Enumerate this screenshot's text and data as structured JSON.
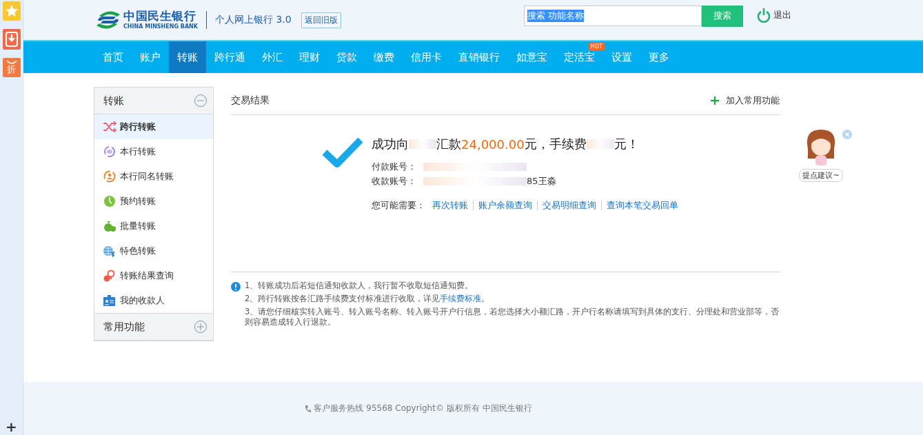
{
  "side_toolbar": {
    "items": [
      {
        "kind": "star"
      },
      {
        "kind": "download"
      },
      {
        "kind": "discount",
        "label": "折"
      }
    ],
    "add": "+"
  },
  "header": {
    "logo_cn": "中国民生银行",
    "logo_en": "CHINA MINSHENG BANK",
    "product": "个人网上银行 3.0",
    "old_version": "返回旧版",
    "search": {
      "value": "搜索 功能名称",
      "button": "搜索"
    },
    "logout": "退出"
  },
  "nav": [
    {
      "label": "首页",
      "selected": false
    },
    {
      "label": "账户",
      "selected": false
    },
    {
      "label": "转账",
      "selected": true
    },
    {
      "label": "跨行通",
      "selected": false
    },
    {
      "label": "外汇",
      "selected": false
    },
    {
      "label": "理财",
      "selected": false
    },
    {
      "label": "贷款",
      "selected": false
    },
    {
      "label": "缴费",
      "selected": false
    },
    {
      "label": "信用卡",
      "selected": false
    },
    {
      "label": "直销银行",
      "selected": false
    },
    {
      "label": "如意宝",
      "selected": false
    },
    {
      "label": "定活宝",
      "selected": false,
      "badge": "HOT"
    },
    {
      "label": "设置",
      "selected": false
    },
    {
      "label": "更多",
      "selected": false
    }
  ],
  "sidebar": [
    {
      "title": "转账",
      "expanded": true,
      "items": [
        {
          "label": "跨行转账",
          "kind": "shuffle",
          "selected": true
        },
        {
          "label": "本行转账",
          "kind": "cycle",
          "selected": false
        },
        {
          "label": "本行同名转账",
          "kind": "person",
          "selected": false
        },
        {
          "label": "预约转账",
          "kind": "clock",
          "selected": false
        },
        {
          "label": "批量转账",
          "kind": "bags",
          "selected": false
        },
        {
          "label": "特色转账",
          "kind": "globe",
          "selected": false
        },
        {
          "label": "转账结果查询",
          "kind": "query",
          "selected": false
        },
        {
          "label": "我的收款人",
          "kind": "card",
          "selected": false
        }
      ]
    },
    {
      "title": "常用功能",
      "expanded": false
    }
  ],
  "main": {
    "title": "交易结果",
    "add_favorite": "加入常用功能",
    "result": {
      "message": [
        {
          "kind": "text",
          "text": "成功向"
        },
        {
          "kind": "redacted"
        },
        {
          "kind": "text",
          "text": "汇款"
        },
        {
          "kind": "amount",
          "text": "24,000.00"
        },
        {
          "kind": "text",
          "text": "元，手续费"
        },
        {
          "kind": "redacted"
        },
        {
          "kind": "text",
          "text": "元！"
        }
      ],
      "fields": [
        {
          "label": "付款账号："
        },
        {
          "label": "收款账号：",
          "visible_tail": "85王淼"
        }
      ],
      "suggest_label": "您可能需要：",
      "links": [
        "再次转账",
        "账户余额查询",
        "交易明细查询",
        "查询本笔交易回单"
      ]
    },
    "notes": [
      {
        "text": "1、转账成功后若短信通知收款人，我行暂不收取短信通知费。"
      },
      {
        "text": "2、跨行转账按各汇路手续费支付标准进行收取，详见",
        "link": "手续费标准",
        "tail": "。"
      },
      {
        "text": "3、请您仔细核实转入账号、转入账号名称、转入账号开户行信息，若您选择大小额汇路，开户行名称请填写到具体的支行、分理处和营业部等，否则容易造成转入行退款。"
      }
    ]
  },
  "assistant": {
    "label": "提点建议~"
  },
  "footer": {
    "text": "客户服务热线 95568 Copyright© 版权所有 中国民生银行"
  }
}
